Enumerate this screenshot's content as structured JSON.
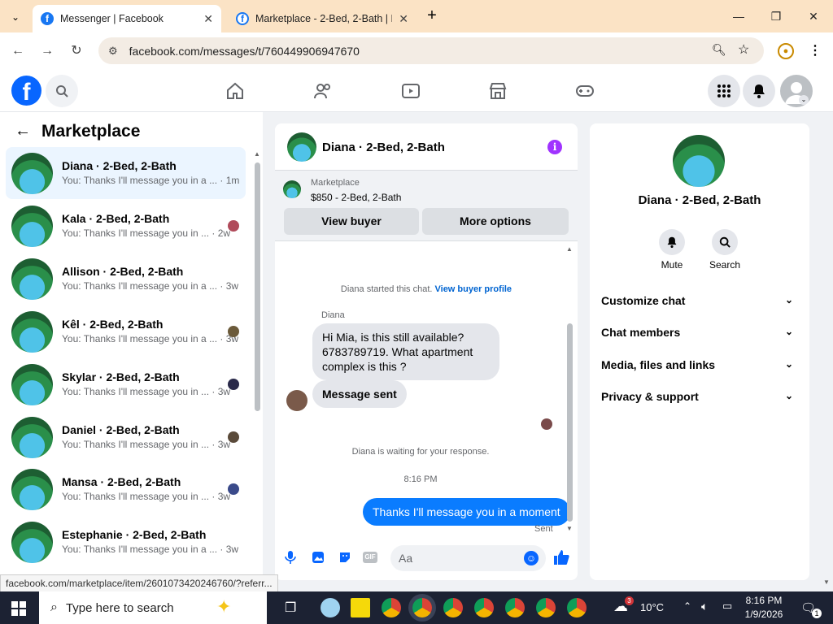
{
  "browser": {
    "tabs": [
      {
        "title": "Messenger | Facebook",
        "active": true
      },
      {
        "title": "Marketplace - 2-Bed, 2-Bath | F",
        "active": false
      }
    ],
    "url": "facebook.com/messages/t/760449906947670"
  },
  "left_panel": {
    "title": "Marketplace",
    "conversations": [
      {
        "name": "Diana · 2-Bed, 2-Bath",
        "snippet": "You: Thanks I'll message you in a ...",
        "time": "· 1m",
        "selected": true
      },
      {
        "name": "Kala · 2-Bed, 2-Bath",
        "snippet": "You: Thanks I'll message you in ...",
        "time": "· 2w"
      },
      {
        "name": "Allison · 2-Bed, 2-Bath",
        "snippet": "You: Thanks I'll message you in a ...",
        "time": "· 3w"
      },
      {
        "name": "Kêl · 2-Bed, 2-Bath",
        "snippet": "You: Thanks I'll message you in a ...",
        "time": "· 3w"
      },
      {
        "name": "Skylar · 2-Bed, 2-Bath",
        "snippet": "You: Thanks I'll message you in ...",
        "time": "· 3w"
      },
      {
        "name": "Daniel · 2-Bed, 2-Bath",
        "snippet": "You: Thanks I'll message you in ...",
        "time": "· 3w"
      },
      {
        "name": "Mansa · 2-Bed, 2-Bath",
        "snippet": "You: Thanks I'll message you in ...",
        "time": "· 3w"
      },
      {
        "name": "Estephanie · 2-Bed, 2-Bath",
        "snippet": "You: Thanks I'll message you in a ...",
        "time": "· 3w"
      }
    ]
  },
  "chat": {
    "header_title": "Diana · 2-Bed, 2-Bath",
    "listing_source": "Marketplace",
    "listing_price": "$850 - 2-Bed, 2-Bath",
    "view_buyer_label": "View buyer",
    "more_options_label": "More options",
    "started_text": "Diana started this chat.",
    "view_profile_link": "View buyer profile",
    "sender_name": "Diana",
    "incoming_message": "Hi Mia, is this still available? 6783789719. What apartment complex is this ?",
    "message_sent_text": "Message sent",
    "waiting_text": "Diana is waiting for your response.",
    "timestamp": "8:16 PM",
    "outgoing_message": "Thanks I'll message you in a moment",
    "sent_status": "Sent",
    "composer_placeholder": "Aa"
  },
  "right_panel": {
    "name": "Diana · 2-Bed, 2-Bath",
    "mute_label": "Mute",
    "search_label": "Search",
    "sections": [
      "Customize chat",
      "Chat members",
      "Media, files and links",
      "Privacy & support"
    ]
  },
  "status_bar": {
    "text": "facebook.com/marketplace/item/2601073420246760/?referr..."
  },
  "taskbar": {
    "search_placeholder": "Type here to search",
    "weather_temp": "10°C",
    "weather_badge": "3",
    "time": "8:16 PM",
    "date": "1/9/2026",
    "notification_count": "1"
  },
  "colors": {
    "accent": "#0866ff",
    "brand": "#1877f2",
    "info": "#a033ff",
    "outgoing_bubble": "#0a7cff"
  }
}
